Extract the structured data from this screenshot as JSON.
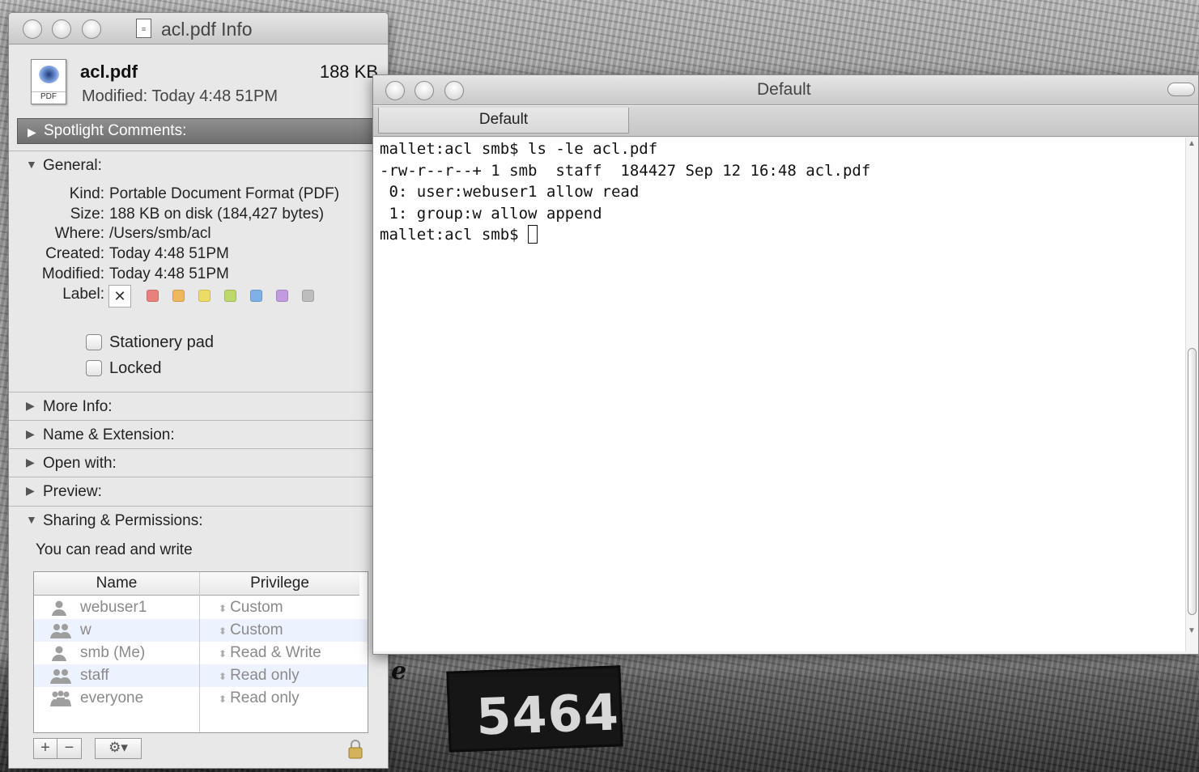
{
  "info_window": {
    "title": "acl.pdf Info",
    "file_name": "acl.pdf",
    "file_size": "188 KB",
    "modified_header": "Modified: Today 4:48 51PM",
    "icon_label": "PDF",
    "sections": {
      "spotlight": "Spotlight Comments:",
      "general": "General:",
      "more_info": "More Info:",
      "name_extension": "Name & Extension:",
      "open_with": "Open with:",
      "preview": "Preview:",
      "sharing": "Sharing & Permissions:"
    },
    "general": {
      "kind_label": "Kind:",
      "kind": "Portable Document Format (PDF)",
      "size_label": "Size:",
      "size": "188 KB on disk (184,427 bytes)",
      "where_label": "Where:",
      "where": "/Users/smb/acl",
      "created_label": "Created:",
      "created": "Today 4:48 51PM",
      "modified_label": "Modified:",
      "modified": "Today 4:48 51PM",
      "label_label": "Label:",
      "label_clear": "✕",
      "label_colors": [
        "#e8807c",
        "#efb85c",
        "#ecdc66",
        "#bdd96a",
        "#7fb0e8",
        "#c29ade",
        "#bdbdbd"
      ],
      "stationery": "Stationery pad",
      "locked": "Locked"
    },
    "sharing": {
      "summary": "You can read and write",
      "col_name": "Name",
      "col_privilege": "Privilege",
      "rows": [
        {
          "icon": "user-icon",
          "name": "webuser1",
          "privilege": "Custom"
        },
        {
          "icon": "group-icon",
          "name": "w",
          "privilege": "Custom"
        },
        {
          "icon": "user-icon",
          "name": "smb (Me)",
          "privilege": "Read & Write"
        },
        {
          "icon": "group-icon",
          "name": "staff",
          "privilege": "Read only"
        },
        {
          "icon": "everyone-icon",
          "name": "everyone",
          "privilege": "Read only"
        }
      ],
      "add": "+",
      "remove": "−",
      "action": "⚙▾"
    }
  },
  "terminal": {
    "title": "Default",
    "tab": "Default",
    "lines": [
      "mallet:acl smb$ ls -le acl.pdf",
      "-rw-r--r--+ 1 smb  staff  184427 Sep 12 16:48 acl.pdf",
      " 0: user:webuser1 allow read",
      " 1: group:w allow append",
      "mallet:acl smb$ "
    ]
  },
  "background": {
    "sign_number": "5464",
    "sign_letter": "e"
  }
}
